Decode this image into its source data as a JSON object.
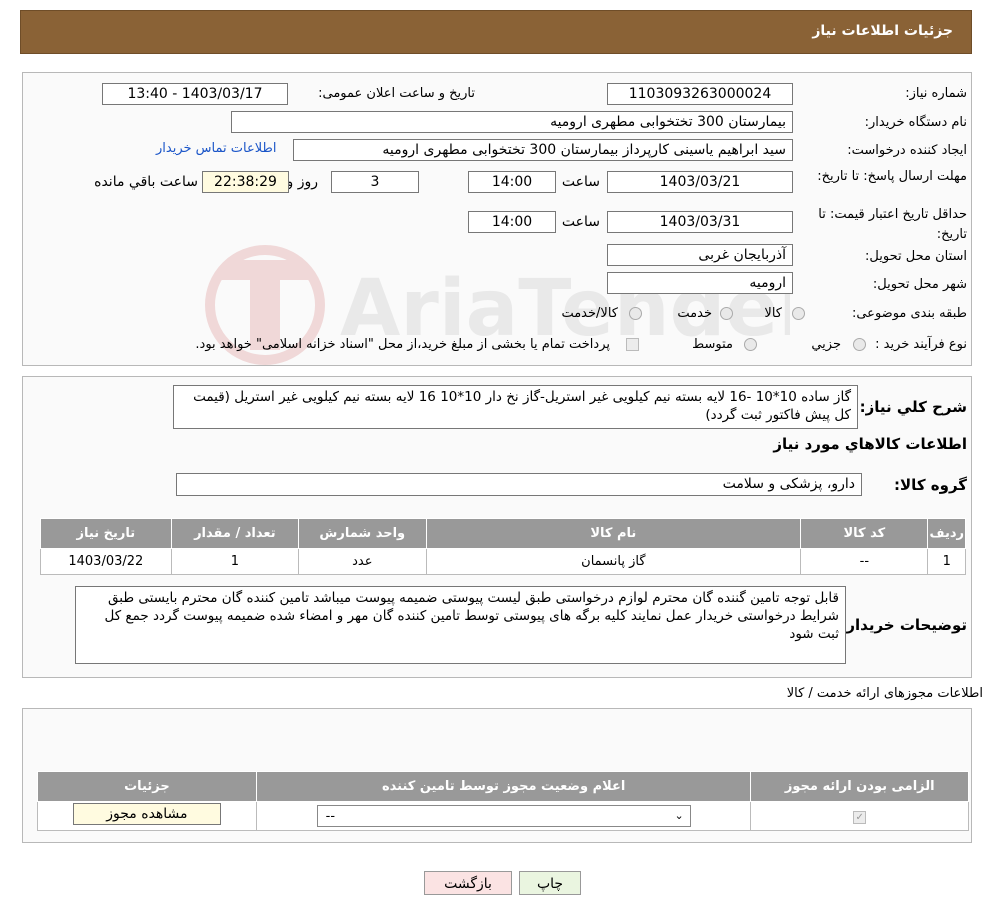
{
  "header": {
    "title": "جزئیات اطلاعات نیاز"
  },
  "info": {
    "need_number_label": "شماره نیاز:",
    "need_number": "1103093263000024",
    "announce_label": "تاریخ و ساعت اعلان عمومی:",
    "announce_value": "1403/03/17 - 13:40",
    "buyer_label": "نام دستگاه خریدار:",
    "buyer_value": "بیمارستان 300 تختخوابی مطهری  ارومیه",
    "creator_label": "ایجاد کننده درخواست:",
    "creator_value": "سید ابراهیم یاسینی کارپرداز بیمارستان 300 تختخوابی مطهری  ارومیه",
    "contact_link": "اطلاعات تماس خریدار",
    "deadline_label": "مهلت ارسال پاسخ: تا تاریخ:",
    "deadline_date": "1403/03/21",
    "hour_label": "ساعت",
    "deadline_time": "14:00",
    "days_value": "3",
    "days_label": "روز و",
    "remaining_time": "22:38:29",
    "remaining_label": "ساعت باقي مانده",
    "validity_label": "حداقل تاریخ اعتبار قیمت: تا تاریخ:",
    "validity_date": "1403/03/31",
    "validity_time": "14:00",
    "province_label": "استان محل تحویل:",
    "province_value": "آذربایجان غربی",
    "city_label": "شهر محل تحویل:",
    "city_value": "ارومیه",
    "category_label": "طبقه بندی موضوعی:",
    "category_options": [
      "کالا",
      "خدمت",
      "کالا/خدمت"
    ],
    "process_label": "نوع فرآیند خرید :",
    "process_options": [
      "جزیي",
      "متوسط"
    ],
    "process_note": "پرداخت تمام یا بخشی از مبلغ خرید،از محل \"اسناد خزانه اسلامی\" خواهد بود."
  },
  "description": {
    "label": "شرح کلي نياز:",
    "value": "گاز ساده 10*10 -16 لایه بسته نیم کیلویی غیر استریل-گاز نخ دار 10*10 16 لایه بسته نیم کیلویی غیر استریل (قیمت کل پیش فاکتور ثبت گردد)",
    "goods_heading": "اطلاعات کالاهاي مورد نياز",
    "group_label": "گروه کالا:",
    "group_value": "دارو، پزشکی و سلامت"
  },
  "goods_table": {
    "headers": [
      "رديف",
      "کد کالا",
      "نام کالا",
      "واحد شمارش",
      "تعداد / مقدار",
      "تاریخ نیاز"
    ],
    "rows": [
      [
        "1",
        "--",
        "گاز پانسمان",
        "عدد",
        "1",
        "1403/03/22"
      ]
    ]
  },
  "buyer_notes": {
    "label": "توضیحات خریدار:",
    "value": "قابل توجه تامین گننده گان محترم لوازم درخواستی طبق لیست پیوستی ضمیمه پیوست میباشد تامین کننده گان محترم بایستی طبق شرایط درخواستی خریدار عمل نمایند کلیه برگه های پیوستی توسط تامین کننده گان مهر و امضاء شده ضمیمه پیوست گردد جمع کل ثبت شود"
  },
  "permits": {
    "heading": "اطلاعات مجوزهای ارائه خدمت / کالا",
    "headers": [
      "الزامی بودن ارائه مجوز",
      "اعلام وضعیت مجوز توسط تامین کننده",
      "جزئیات"
    ],
    "select_value": "--",
    "view_button": "مشاهده مجوز"
  },
  "buttons": {
    "print": "چاپ",
    "back": "بازگشت"
  },
  "watermark": {
    "text": "AriaTender.neT"
  }
}
